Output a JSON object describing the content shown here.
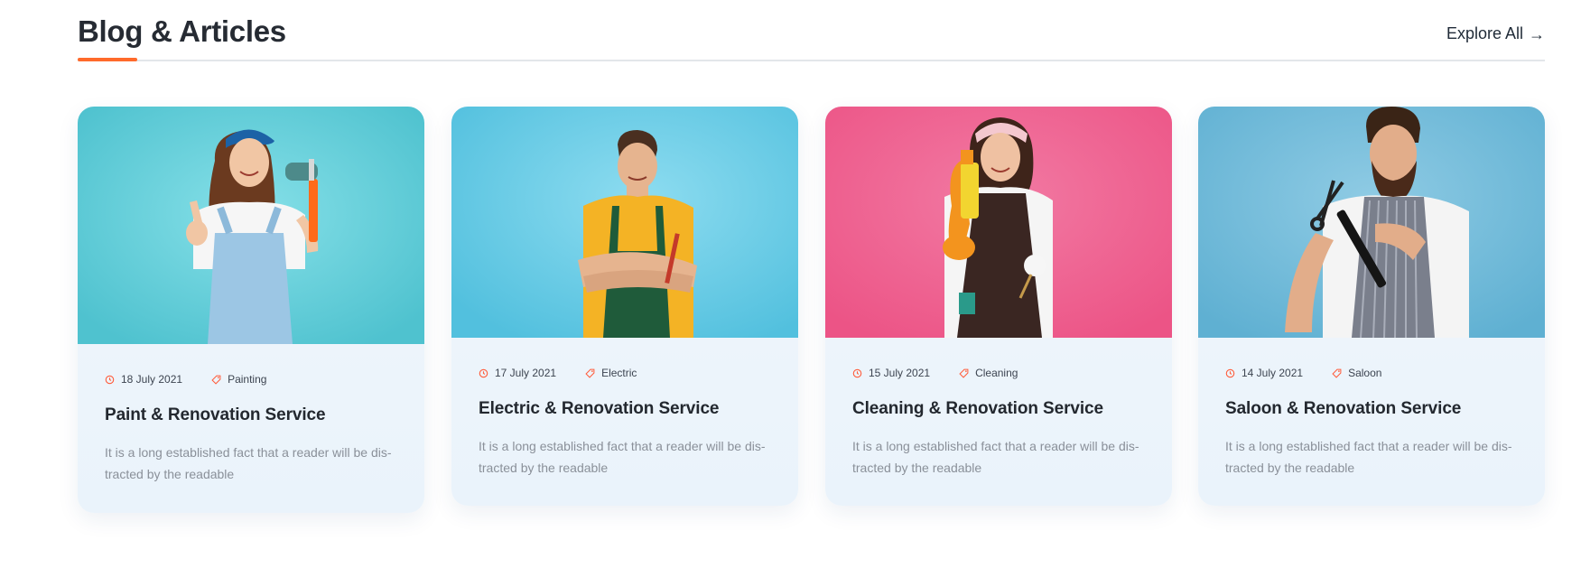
{
  "header": {
    "title": "Blog & Articles",
    "explore_label": "Explore All",
    "explore_arrow": "→",
    "accent_color": "#ff6a2b"
  },
  "cards": [
    {
      "date": "18 July 2021",
      "category": "Painting",
      "title": "Paint & Renovation Service",
      "excerpt": "It is a long established fact that a reader will be dis-tracted by the readable",
      "image_subject": "woman-painter-with-roller",
      "image_bg": "#5ecbd6"
    },
    {
      "date": "17 July 2021",
      "category": "Electric",
      "title": "Electric & Renovation Service",
      "excerpt": "It is a long established fact that a reader will be dis-tracted by the readable",
      "image_subject": "man-electrician-arms-crossed",
      "image_bg": "#66cbe3"
    },
    {
      "date": "15 July 2021",
      "category": "Cleaning",
      "title": "Cleaning & Renovation Service",
      "excerpt": "It is a long established fact that a reader will be dis-tracted by the readable",
      "image_subject": "woman-cleaner-with-spray",
      "image_bg": "#f0608f"
    },
    {
      "date": "14 July 2021",
      "category": "Saloon",
      "title": "Saloon & Renovation Service",
      "excerpt": "It is a long established fact that a reader will be dis-tracted by the readable",
      "image_subject": "man-barber-with-scissors",
      "image_bg": "#6fb8d8"
    }
  ]
}
